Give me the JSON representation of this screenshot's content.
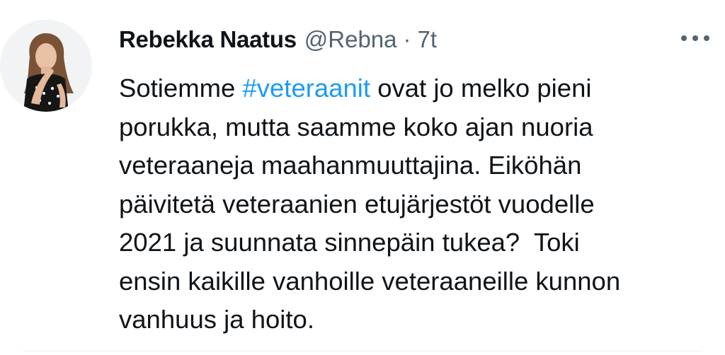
{
  "tweet": {
    "author": {
      "display_name": "Rebekka Naatus",
      "handle": "@Rebna",
      "avatar_icon": "profile-photo"
    },
    "separator": "·",
    "timestamp": "7t",
    "more_icon": "more-horizontal-icon",
    "lines": [
      {
        "before": "Sotiemme ",
        "hashtag": "#veteraanit",
        "after": " ovat jo melko pieni"
      },
      {
        "text": "porukka, mutta saamme koko ajan nuoria"
      },
      {
        "text": "veteraaneja maahanmuuttajina. Eiköhän"
      },
      {
        "text": "päivitetä veteraanien etujärjestöt vuodelle"
      },
      {
        "text": "2021 ja suunnata sinnepäin tukea?  Toki"
      },
      {
        "text": "ensin kaikille vanhoille veteraaneille kunnon"
      },
      {
        "text": "vanhuus ja hoito."
      }
    ]
  },
  "colors": {
    "text": "#0f1419",
    "secondary": "#536471",
    "link": "#1d9bf0",
    "background": "#ffffff"
  }
}
